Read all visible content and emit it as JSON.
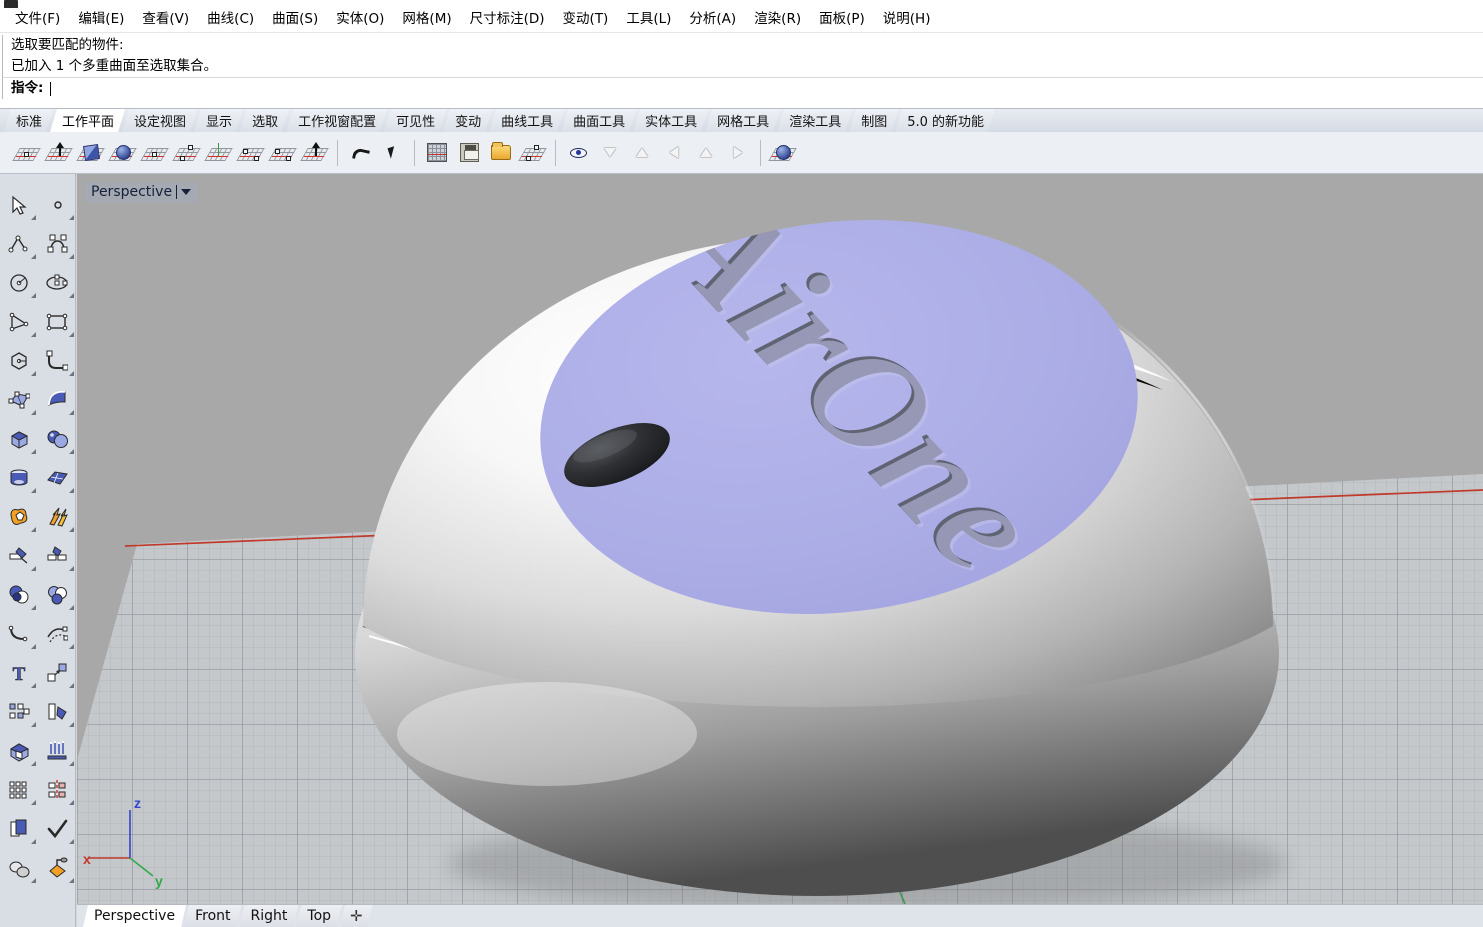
{
  "app": {
    "title_icon": "app-icon"
  },
  "menubar": {
    "items": [
      {
        "label": "文件(F)",
        "name": "menu-file"
      },
      {
        "label": "编辑(E)",
        "name": "menu-edit"
      },
      {
        "label": "查看(V)",
        "name": "menu-view"
      },
      {
        "label": "曲线(C)",
        "name": "menu-curve"
      },
      {
        "label": "曲面(S)",
        "name": "menu-surface"
      },
      {
        "label": "实体(O)",
        "name": "menu-solid"
      },
      {
        "label": "网格(M)",
        "name": "menu-mesh"
      },
      {
        "label": "尺寸标注(D)",
        "name": "menu-dimension"
      },
      {
        "label": "变动(T)",
        "name": "menu-transform"
      },
      {
        "label": "工具(L)",
        "name": "menu-tools"
      },
      {
        "label": "分析(A)",
        "name": "menu-analyze"
      },
      {
        "label": "渲染(R)",
        "name": "menu-render"
      },
      {
        "label": "面板(P)",
        "name": "menu-panels"
      },
      {
        "label": "说明(H)",
        "name": "menu-help"
      }
    ]
  },
  "command_area": {
    "history": [
      "选取要匹配的物件:",
      "已加入 1 个多重曲面至选取集合。"
    ],
    "prompt_label": "指令:",
    "prompt_value": "",
    "prompt_placeholder": ""
  },
  "toolbar_tabs": {
    "active": "工作平面",
    "items": [
      {
        "label": "标准",
        "name": "tab-standard"
      },
      {
        "label": "工作平面",
        "name": "tab-cplane"
      },
      {
        "label": "设定视图",
        "name": "tab-set-view"
      },
      {
        "label": "显示",
        "name": "tab-display"
      },
      {
        "label": "选取",
        "name": "tab-select"
      },
      {
        "label": "工作视窗配置",
        "name": "tab-viewport-layout"
      },
      {
        "label": "可见性",
        "name": "tab-visibility"
      },
      {
        "label": "变动",
        "name": "tab-transform"
      },
      {
        "label": "曲线工具",
        "name": "tab-curve-tools"
      },
      {
        "label": "曲面工具",
        "name": "tab-surface-tools"
      },
      {
        "label": "实体工具",
        "name": "tab-solid-tools"
      },
      {
        "label": "网格工具",
        "name": "tab-mesh-tools"
      },
      {
        "label": "渲染工具",
        "name": "tab-render-tools"
      },
      {
        "label": "制图",
        "name": "tab-drafting"
      },
      {
        "label": "5.0 的新功能",
        "name": "tab-whats-new-50"
      }
    ]
  },
  "icon_toolbar": {
    "buttons": [
      {
        "name": "cplane-origin-icon",
        "kind": "grid-pt"
      },
      {
        "name": "cplane-elevation-icon",
        "kind": "grid-up"
      },
      {
        "name": "cplane-to-object-icon",
        "kind": "grid-cube"
      },
      {
        "name": "cplane-to-surface-icon",
        "kind": "grid-sphere"
      },
      {
        "name": "cplane-3point-icon",
        "kind": "grid-pt"
      },
      {
        "name": "cplane-curve-icon",
        "kind": "grid-curve"
      },
      {
        "name": "cplane-world-icon",
        "kind": "grid-axis"
      },
      {
        "name": "cplane-rotate-icon",
        "kind": "grid-2pt"
      },
      {
        "name": "cplane-align-icon",
        "kind": "grid-2pt"
      },
      {
        "name": "cplane-perp-curve-icon",
        "kind": "grid-up"
      },
      {
        "name": "cplane-undo-icon",
        "kind": "undo"
      },
      {
        "name": "cplane-next-icon",
        "kind": "cursor"
      },
      {
        "name": "grid-settings-icon",
        "kind": "gridsq"
      },
      {
        "name": "save-cplane-icon",
        "kind": "floppy"
      },
      {
        "name": "restore-cplane-icon",
        "kind": "folder"
      },
      {
        "name": "named-cplane-icon",
        "kind": "grid-curve"
      },
      {
        "name": "cplane-through-point-icon",
        "kind": "eye"
      },
      {
        "name": "cplane-to-view-icon",
        "kind": "arrow-dn"
      },
      {
        "name": "cplane-from-view-icon",
        "kind": "arrow-up"
      },
      {
        "name": "cplane-left-icon",
        "kind": "arrow-lf"
      },
      {
        "name": "cplane-right-icon",
        "kind": "arrow-up"
      },
      {
        "name": "cplane-swap-icon",
        "kind": "arrow-lr"
      },
      {
        "name": "cplane-to-solid-icon",
        "kind": "grid-sphere"
      }
    ]
  },
  "sidebar": {
    "items": [
      {
        "name": "select-arrow-icon",
        "glyph": "arrow"
      },
      {
        "name": "point-icon",
        "glyph": "point"
      },
      {
        "name": "polyline-icon",
        "glyph": "polyline"
      },
      {
        "name": "control-point-curve-icon",
        "glyph": "cpcurve"
      },
      {
        "name": "circle-icon",
        "glyph": "circle"
      },
      {
        "name": "ellipse-icon",
        "glyph": "ellipse"
      },
      {
        "name": "arc-icon",
        "glyph": "arc3"
      },
      {
        "name": "rectangle-icon",
        "glyph": "rect"
      },
      {
        "name": "polygon-icon",
        "glyph": "polygon"
      },
      {
        "name": "curve-fillet-icon",
        "glyph": "fillet"
      },
      {
        "name": "surface-from-points-icon",
        "glyph": "srfpts"
      },
      {
        "name": "loft-surface-icon",
        "glyph": "loft"
      },
      {
        "name": "box-icon",
        "glyph": "box"
      },
      {
        "name": "sphere-icon",
        "glyph": "spheres"
      },
      {
        "name": "cylinder-icon",
        "glyph": "cylinder"
      },
      {
        "name": "mesh-plane-icon",
        "glyph": "meshplane"
      },
      {
        "name": "boolean-union-icon",
        "glyph": "boolunion"
      },
      {
        "name": "explode-icon",
        "glyph": "explode"
      },
      {
        "name": "trim-icon",
        "glyph": "trim"
      },
      {
        "name": "split-icon",
        "glyph": "split"
      },
      {
        "name": "boolean-difference-icon",
        "glyph": "booldiff"
      },
      {
        "name": "boolean-intersection-icon",
        "glyph": "boolint"
      },
      {
        "name": "fillet-edge-icon",
        "glyph": "filletedge"
      },
      {
        "name": "offset-curve-icon",
        "glyph": "offsetcrv"
      },
      {
        "name": "text-object-icon",
        "glyph": "text"
      },
      {
        "name": "scale-icon",
        "glyph": "scale"
      },
      {
        "name": "array-icon",
        "glyph": "array"
      },
      {
        "name": "rotate-icon",
        "glyph": "rotate"
      },
      {
        "name": "cap-planar-holes-icon",
        "glyph": "cap"
      },
      {
        "name": "extrude-icon",
        "glyph": "extrude"
      },
      {
        "name": "rectangular-array-icon",
        "glyph": "rectarray"
      },
      {
        "name": "mirror-icon",
        "glyph": "mirror"
      },
      {
        "name": "copy-icon",
        "glyph": "copy"
      },
      {
        "name": "check-icon",
        "glyph": "check"
      },
      {
        "name": "solid-tools-icon",
        "glyph": "solidtools"
      },
      {
        "name": "render-color-icon",
        "glyph": "paint"
      }
    ]
  },
  "viewport": {
    "label": "Perspective",
    "background_color": "#a8a8a8",
    "grid_color": "#c3c7cc",
    "grid_line_color": "#8e949c",
    "axis_x_color": "#c0392b",
    "axis_y_color": "#2fa94a",
    "axis_z_color": "#3344cc",
    "axis_labels": {
      "x": "x",
      "y": "y",
      "z": "z"
    },
    "model": {
      "name": "dome-product-model",
      "body_color": "#f3f3f3",
      "top_panel_color": "#a9aae2",
      "button_color": "#2a2a2a",
      "embossed_text": "AirOne",
      "emboss_color": "#555a66"
    }
  },
  "viewport_tabs": {
    "active": "Perspective",
    "items": [
      {
        "label": "Perspective",
        "name": "viewport-tab-perspective"
      },
      {
        "label": "Front",
        "name": "viewport-tab-front"
      },
      {
        "label": "Right",
        "name": "viewport-tab-right"
      },
      {
        "label": "Top",
        "name": "viewport-tab-top"
      }
    ],
    "add_label": "✛"
  }
}
